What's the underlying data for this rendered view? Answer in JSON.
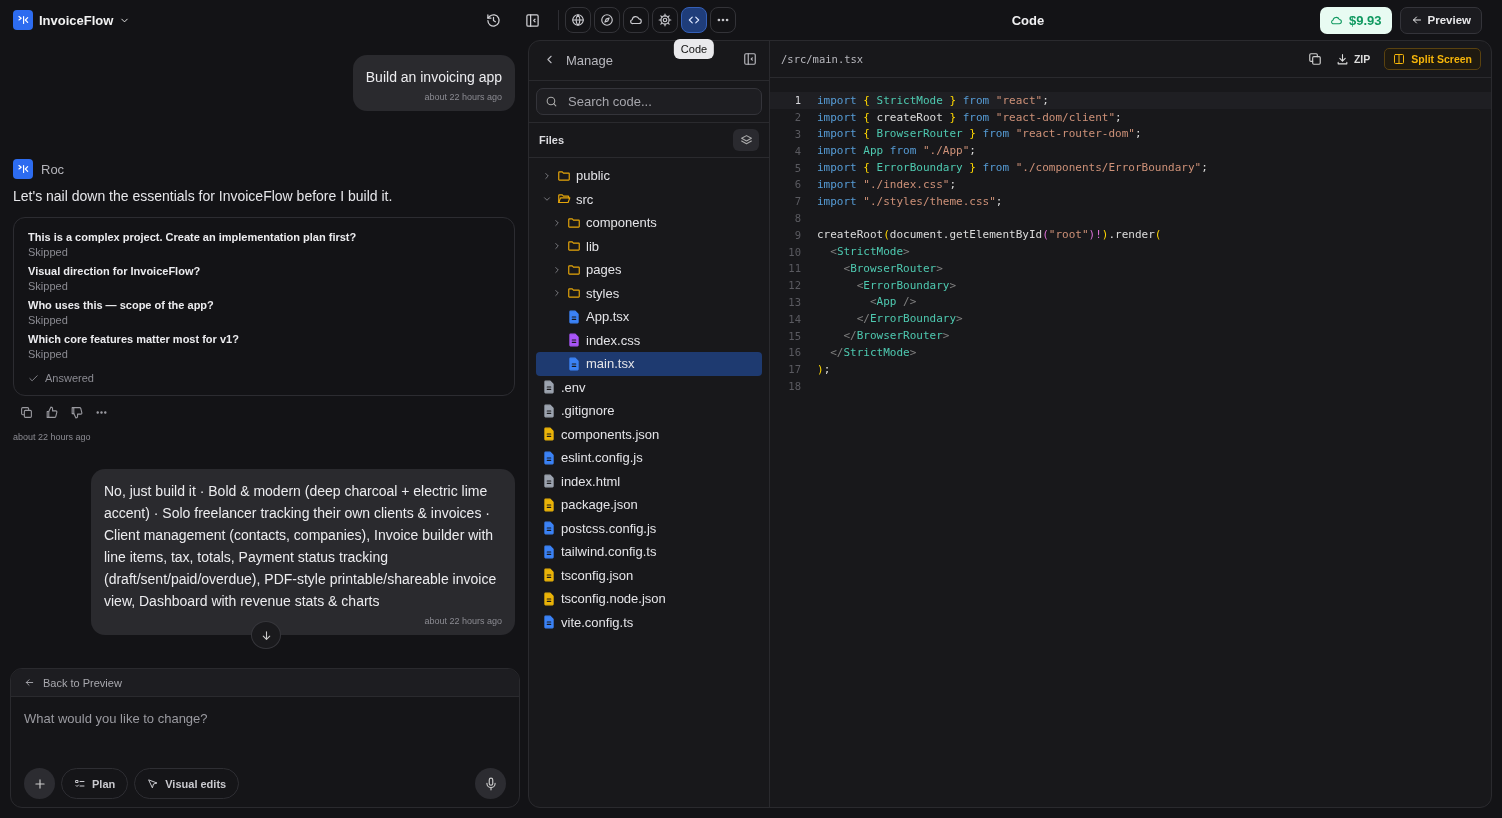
{
  "app": {
    "name": "InvoiceFlow"
  },
  "toolbar": {
    "tools": [
      {
        "selected": false
      },
      {
        "selected": false
      },
      {
        "selected": false
      },
      {
        "selected": false
      },
      {
        "selected": true
      },
      {
        "selected": false
      }
    ],
    "tooltip": "Code"
  },
  "header": {
    "title": "Code",
    "credits": "$9.93",
    "preview_button": "Preview"
  },
  "chat": {
    "messages": [
      {
        "kind": "user",
        "text": "Build an invoicing app",
        "time": "about 22 hours ago"
      },
      {
        "kind": "assistant",
        "author": "Roc",
        "text": "Let's nail down the essentials for InvoiceFlow before I build it.",
        "questions": [
          {
            "question": "This is a complex project. Create an implementation plan first?",
            "answer": "Skipped"
          },
          {
            "question": "Visual direction for InvoiceFlow?",
            "answer": "Skipped"
          },
          {
            "question": "Who uses this — scope of the app?",
            "answer": "Skipped"
          },
          {
            "question": "Which core features matter most for v1?",
            "answer": "Skipped"
          }
        ],
        "status": "Answered",
        "time": "about 22 hours ago"
      },
      {
        "kind": "user",
        "text": "No, just build it · Bold & modern (deep charcoal + electric lime accent) · Solo freelancer tracking their own clients & invoices · Client management (contacts, companies), Invoice builder with line items, tax, totals, Payment status tracking (draft/sent/paid/overdue), PDF-style printable/shareable invoice view, Dashboard with revenue stats & charts",
        "time": "about 22 hours ago"
      }
    ]
  },
  "composer": {
    "back_link": "Back to Preview",
    "placeholder": "What would you like to change?",
    "buttons": [
      "Plan",
      "Visual edits"
    ]
  },
  "files_panel": {
    "title": "Manage",
    "search_placeholder": "Search code...",
    "heading": "Files",
    "tree": [
      {
        "kind": "folder",
        "name": "public",
        "expanded": false,
        "selected": false
      },
      {
        "kind": "folder",
        "name": "src",
        "expanded": true,
        "selected": false,
        "children": [
          {
            "kind": "folder",
            "name": "components",
            "expanded": false,
            "selected": false
          },
          {
            "kind": "folder",
            "name": "lib",
            "expanded": false,
            "selected": false
          },
          {
            "kind": "folder",
            "name": "pages",
            "expanded": false,
            "selected": false
          },
          {
            "kind": "folder",
            "name": "styles",
            "expanded": false,
            "selected": false
          },
          {
            "kind": "file",
            "name": "App.tsx",
            "color": "#3b82f6",
            "selected": false
          },
          {
            "kind": "file",
            "name": "index.css",
            "color": "#a855f7",
            "selected": false
          },
          {
            "kind": "file",
            "name": "main.tsx",
            "color": "#3b82f6",
            "selected": true
          }
        ]
      },
      {
        "kind": "file",
        "name": ".env",
        "color": "#9ca3af",
        "selected": false
      },
      {
        "kind": "file",
        "name": ".gitignore",
        "color": "#9ca3af",
        "selected": false
      },
      {
        "kind": "file",
        "name": "components.json",
        "color": "#eab308",
        "selected": false
      },
      {
        "kind": "file",
        "name": "eslint.config.js",
        "color": "#3b82f6",
        "selected": false
      },
      {
        "kind": "file",
        "name": "index.html",
        "color": "#9ca3af",
        "selected": false
      },
      {
        "kind": "file",
        "name": "package.json",
        "color": "#eab308",
        "selected": false
      },
      {
        "kind": "file",
        "name": "postcss.config.js",
        "color": "#3b82f6",
        "selected": false
      },
      {
        "kind": "file",
        "name": "tailwind.config.ts",
        "color": "#3b82f6",
        "selected": false
      },
      {
        "kind": "file",
        "name": "tsconfig.json",
        "color": "#eab308",
        "selected": false
      },
      {
        "kind": "file",
        "name": "tsconfig.node.json",
        "color": "#eab308",
        "selected": false
      },
      {
        "kind": "file",
        "name": "vite.config.ts",
        "color": "#3b82f6",
        "selected": false
      }
    ]
  },
  "editor": {
    "path": "/src/main.tsx",
    "zip_button": "ZIP",
    "split_button": "Split Screen",
    "lines": [
      {
        "number": "1",
        "current": true,
        "tokens": [
          {
            "kind": "keyword",
            "text": "import "
          },
          {
            "kind": "brace",
            "text": "{"
          },
          {
            "kind": "name",
            "text": " StrictMode "
          },
          {
            "kind": "brace",
            "text": "}"
          },
          {
            "kind": "keyword",
            "text": " from "
          },
          {
            "kind": "string",
            "text": "\"react\""
          },
          {
            "kind": "plain",
            "text": ";"
          }
        ]
      },
      {
        "number": "2",
        "current": false,
        "tokens": [
          {
            "kind": "keyword",
            "text": "import "
          },
          {
            "kind": "brace",
            "text": "{"
          },
          {
            "kind": "plain",
            "text": " createRoot "
          },
          {
            "kind": "brace",
            "text": "}"
          },
          {
            "kind": "keyword",
            "text": " from "
          },
          {
            "kind": "string",
            "text": "\"react-dom/client\""
          },
          {
            "kind": "plain",
            "text": ";"
          }
        ]
      },
      {
        "number": "3",
        "current": false,
        "tokens": [
          {
            "kind": "keyword",
            "text": "import "
          },
          {
            "kind": "brace",
            "text": "{"
          },
          {
            "kind": "name",
            "text": " BrowserRouter "
          },
          {
            "kind": "brace",
            "text": "}"
          },
          {
            "kind": "keyword",
            "text": " from "
          },
          {
            "kind": "string",
            "text": "\"react-router-dom\""
          },
          {
            "kind": "plain",
            "text": ";"
          }
        ]
      },
      {
        "number": "4",
        "current": false,
        "tokens": [
          {
            "kind": "keyword",
            "text": "import "
          },
          {
            "kind": "name",
            "text": "App"
          },
          {
            "kind": "keyword",
            "text": " from "
          },
          {
            "kind": "string",
            "text": "\"./App\""
          },
          {
            "kind": "plain",
            "text": ";"
          }
        ]
      },
      {
        "number": "5",
        "current": false,
        "tokens": [
          {
            "kind": "keyword",
            "text": "import "
          },
          {
            "kind": "brace",
            "text": "{"
          },
          {
            "kind": "name",
            "text": " ErrorBoundary "
          },
          {
            "kind": "brace",
            "text": "}"
          },
          {
            "kind": "keyword",
            "text": " from "
          },
          {
            "kind": "string",
            "text": "\"./components/ErrorBoundary\""
          },
          {
            "kind": "plain",
            "text": ";"
          }
        ]
      },
      {
        "number": "6",
        "current": false,
        "tokens": [
          {
            "kind": "keyword",
            "text": "import "
          },
          {
            "kind": "string",
            "text": "\"./index.css\""
          },
          {
            "kind": "plain",
            "text": ";"
          }
        ]
      },
      {
        "number": "7",
        "current": false,
        "tokens": [
          {
            "kind": "keyword",
            "text": "import "
          },
          {
            "kind": "string",
            "text": "\"./styles/theme.css\""
          },
          {
            "kind": "plain",
            "text": ";"
          }
        ]
      },
      {
        "number": "8",
        "current": false
      },
      {
        "number": "9",
        "current": false,
        "tokens": [
          {
            "kind": "plain",
            "text": "createRoot"
          },
          {
            "kind": "brace",
            "text": "("
          },
          {
            "kind": "plain",
            "text": "document.getElementById"
          },
          {
            "kind": "paren",
            "text": "("
          },
          {
            "kind": "string",
            "text": "\"root\""
          },
          {
            "kind": "paren",
            "text": ")!"
          },
          {
            "kind": "brace",
            "text": ")"
          },
          {
            "kind": "plain",
            "text": ".render"
          },
          {
            "kind": "brace",
            "text": "("
          }
        ]
      },
      {
        "number": "10",
        "current": false,
        "tokens": [
          {
            "kind": "angle",
            "text": "  <"
          },
          {
            "kind": "tag",
            "text": "StrictMode"
          },
          {
            "kind": "angle",
            "text": ">"
          }
        ]
      },
      {
        "number": "11",
        "current": false,
        "tokens": [
          {
            "kind": "angle",
            "text": "    <"
          },
          {
            "kind": "tag",
            "text": "BrowserRouter"
          },
          {
            "kind": "angle",
            "text": ">"
          }
        ]
      },
      {
        "number": "12",
        "current": false,
        "tokens": [
          {
            "kind": "angle",
            "text": "      <"
          },
          {
            "kind": "tag",
            "text": "ErrorBoundary"
          },
          {
            "kind": "angle",
            "text": ">"
          }
        ]
      },
      {
        "number": "13",
        "current": false,
        "tokens": [
          {
            "kind": "angle",
            "text": "        <"
          },
          {
            "kind": "tag",
            "text": "App"
          },
          {
            "kind": "angle",
            "text": " />"
          }
        ]
      },
      {
        "number": "14",
        "current": false,
        "tokens": [
          {
            "kind": "angle",
            "text": "      </"
          },
          {
            "kind": "tag",
            "text": "ErrorBoundary"
          },
          {
            "kind": "angle",
            "text": ">"
          }
        ]
      },
      {
        "number": "15",
        "current": false,
        "tokens": [
          {
            "kind": "angle",
            "text": "    </"
          },
          {
            "kind": "tag",
            "text": "BrowserRouter"
          },
          {
            "kind": "angle",
            "text": ">"
          }
        ]
      },
      {
        "number": "16",
        "current": false,
        "tokens": [
          {
            "kind": "angle",
            "text": "  </"
          },
          {
            "kind": "tag",
            "text": "StrictMode"
          },
          {
            "kind": "angle",
            "text": ">"
          }
        ]
      },
      {
        "number": "17",
        "current": false,
        "tokens": [
          {
            "kind": "brace",
            "text": ")"
          },
          {
            "kind": "plain",
            "text": ";"
          }
        ]
      },
      {
        "number": "18",
        "current": false
      }
    ]
  }
}
